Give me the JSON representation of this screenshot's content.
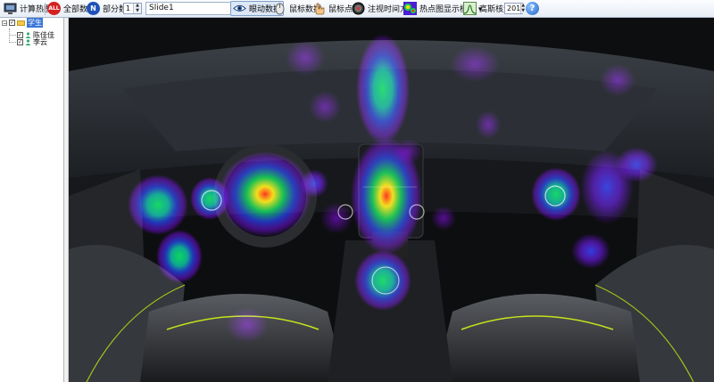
{
  "toolbar": {
    "compute_heatmap_label": "计算热图",
    "all_data_icon_text": "ALL",
    "all_data_label": "全部数据",
    "partial_data_icon_text": "N",
    "partial_data_label": "部分数据",
    "partial_count_value": "1",
    "slide_select_value": "Slide1",
    "eye_data_label": "眼动数据",
    "mouse_data_label": "鼠标数据",
    "mouse_click_label": "鼠标点击",
    "gaze_time_label": "注视时间方式",
    "heatmap_mode_label": "热点图显示模式 ▾",
    "gaussian_label": "高斯核大小",
    "gaussian_value": "201",
    "help_label": "?"
  },
  "tree": {
    "root_label": "学生",
    "children": [
      {
        "label": "陈佳佳",
        "checked": true
      },
      {
        "label": "李云",
        "checked": true
      }
    ]
  },
  "heatmap": {
    "subject": "car interior dashboard",
    "palette": [
      "#7a00ff",
      "#1d3bff",
      "#00d84a",
      "#ffe600",
      "#ff2a00"
    ]
  }
}
